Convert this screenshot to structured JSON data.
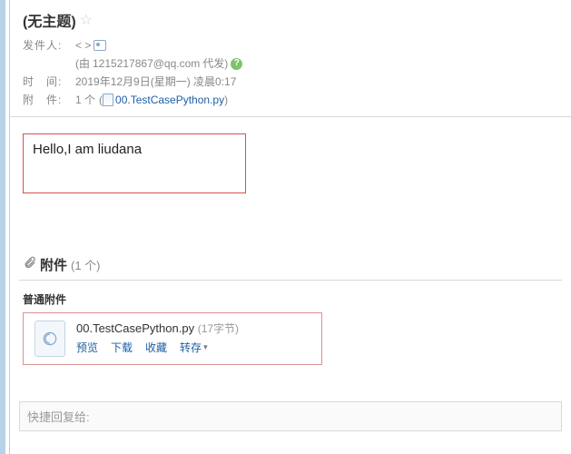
{
  "subject": "(无主题)",
  "meta": {
    "sender_label": "发件人:",
    "sender_value": "< >",
    "proxy_prefix": "(由 ",
    "proxy_email": "1215217867@qq.com",
    "proxy_suffix": " 代发)",
    "time_label": "时　间:",
    "time_value": "2019年12月9日(星期一) 凌晨0:17",
    "attach_label": "附　件:",
    "attach_count_text": "1 个",
    "attach_paren_open": "(",
    "attach_file": "00.TestCasePython.py",
    "attach_paren_close": ")"
  },
  "body_text": "Hello,I am liudana",
  "attachments": {
    "section_title": "附件",
    "section_count": "(1 个)",
    "subtitle": "普通附件",
    "item": {
      "name": "00.TestCasePython.py",
      "size": "(17字节)",
      "actions": {
        "preview": "预览",
        "download": "下载",
        "favorite": "收藏",
        "saveto": "转存"
      }
    }
  },
  "quick_reply_placeholder": "快捷回复给:"
}
